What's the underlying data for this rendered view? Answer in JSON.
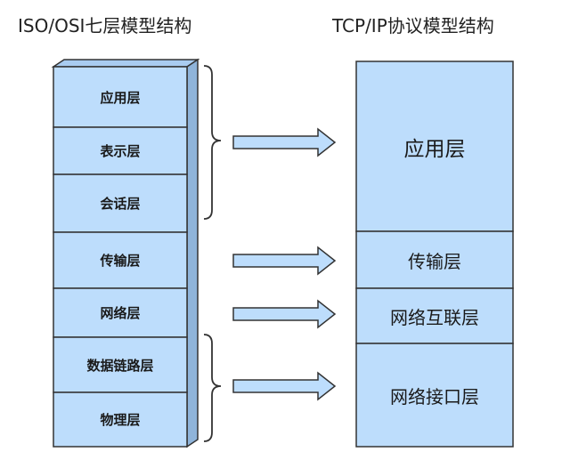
{
  "titles": {
    "osi": "ISO/OSI七层模型结构",
    "tcpip": "TCP/IP协议模型结构"
  },
  "osi_layers": [
    {
      "label": "应用层"
    },
    {
      "label": "表示层"
    },
    {
      "label": "会话层"
    },
    {
      "label": "传输层"
    },
    {
      "label": "网络层"
    },
    {
      "label": "数据链路层"
    },
    {
      "label": "物理层"
    }
  ],
  "tcpip_layers": [
    {
      "label": "应用层"
    },
    {
      "label": "传输层"
    },
    {
      "label": "网络互联层"
    },
    {
      "label": "网络接口层"
    }
  ],
  "colors": {
    "layer_fill": "#BDDDFC",
    "stroke": "#333333",
    "side_face": "#8FB4DA",
    "top_face": "#A9CCF0",
    "arrow_fill": "#BDDDFC"
  }
}
